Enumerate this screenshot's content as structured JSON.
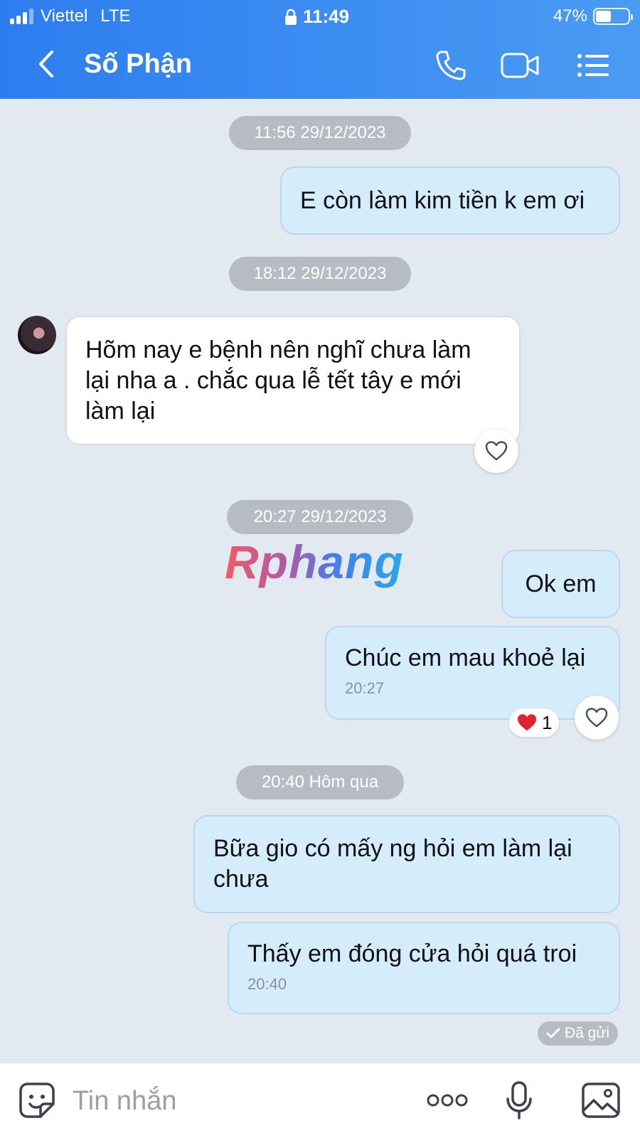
{
  "status_bar": {
    "carrier": "Viettel",
    "network": "LTE",
    "time": "11:49",
    "battery_text": "47%",
    "battery_level": 0.47
  },
  "header": {
    "title": "Số Phận",
    "icons": [
      "back-chevron-icon",
      "phone-call-icon",
      "video-call-icon",
      "menu-list-icon"
    ]
  },
  "messages": [
    {
      "type": "timestamp",
      "text": "11:56 29/12/2023"
    },
    {
      "type": "outgoing",
      "text": "E còn làm kim tiền k em ơi"
    },
    {
      "type": "timestamp",
      "text": "18:12 29/12/2023"
    },
    {
      "type": "incoming",
      "lines": [
        "Hõm nay e bệnh nên nghĩ chưa làm",
        "lại nha a . chắc qua lễ tết tây e mới",
        "làm lại"
      ]
    },
    {
      "type": "timestamp",
      "text": "20:27 29/12/2023"
    },
    {
      "type": "outgoing",
      "text": "Ok em"
    },
    {
      "type": "outgoing",
      "text": "Chúc em mau khoẻ lại",
      "time": "20:27",
      "reaction_count": "1"
    },
    {
      "type": "timestamp",
      "text": "20:40 Hôm qua"
    },
    {
      "type": "outgoing",
      "lines": [
        "Bữa gio có mấy ng hỏi em làm lại",
        "chưa"
      ]
    },
    {
      "type": "outgoing",
      "text": "Thấy em đóng cửa hỏi quá troi",
      "time": "20:40"
    }
  ],
  "sent_status": "Đã gửi",
  "watermark": "Rphang",
  "input": {
    "placeholder": "Tin nhắn",
    "value": ""
  },
  "colors": {
    "header_start": "#2d7df0",
    "header_end": "#4a9bf3",
    "chat_background": "#e2e9f1",
    "outgoing_bubble": "#d5ecfb",
    "incoming_bubble": "#ffffff",
    "heart_red": "#e0242f"
  }
}
